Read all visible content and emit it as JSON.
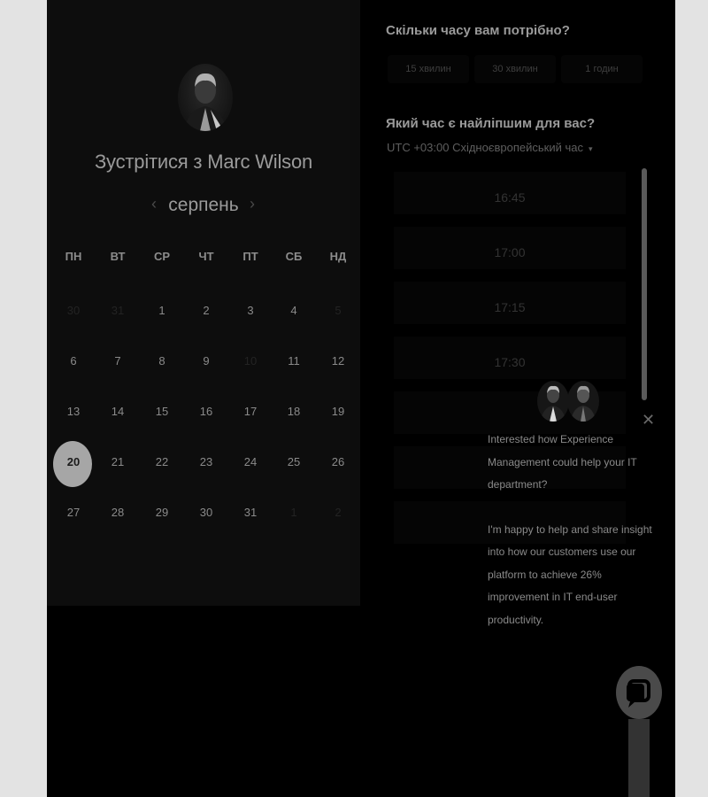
{
  "calendar": {
    "title": "Зустрітися з Marc Wilson",
    "month": "серпень",
    "prev_icon": "‹",
    "next_icon": "›",
    "weekdays": [
      "ПН",
      "ВТ",
      "СР",
      "ЧТ",
      "ПТ",
      "СБ",
      "НД"
    ],
    "weeks": [
      [
        "30",
        "31",
        "1",
        "2",
        "3",
        "4",
        "5"
      ],
      [
        "6",
        "7",
        "8",
        "9",
        "10",
        "11",
        "12"
      ],
      [
        "13",
        "14",
        "15",
        "16",
        "17",
        "18",
        "19"
      ],
      [
        "20",
        "21",
        "22",
        "23",
        "24",
        "25",
        "26"
      ],
      [
        "27",
        "28",
        "29",
        "30",
        "31",
        "1",
        "2"
      ]
    ],
    "muted_days": [
      "0-0",
      "0-1",
      "0-6",
      "1-4",
      "4-5",
      "4-6"
    ],
    "selected_day": "20"
  },
  "scheduler": {
    "duration_question": "Скільки часу вам потрібно?",
    "durations": [
      "15 хвилин",
      "30 хвилин",
      "1 годин"
    ],
    "time_question": "Який час є найліпшим для вас?",
    "timezone": "UTC +03:00 Східноєвропейський час",
    "timezone_caret": "▾",
    "time_slots": [
      "16:45",
      "17:00",
      "17:15",
      "17:30",
      "",
      "",
      ""
    ]
  },
  "chat": {
    "close_icon": "✕",
    "message_1": "Interested how Experience Management could help your IT department?",
    "message_2": "I'm happy to help and share insight into how our customers use our platform to achieve 26% improvement in IT end-user productivity."
  },
  "colors": {
    "page_bg": "#000000",
    "panel_bg": "#0d0d0d",
    "selected_day_bg": "#a6a6a6",
    "outer_bg": "#e3e3e3"
  }
}
